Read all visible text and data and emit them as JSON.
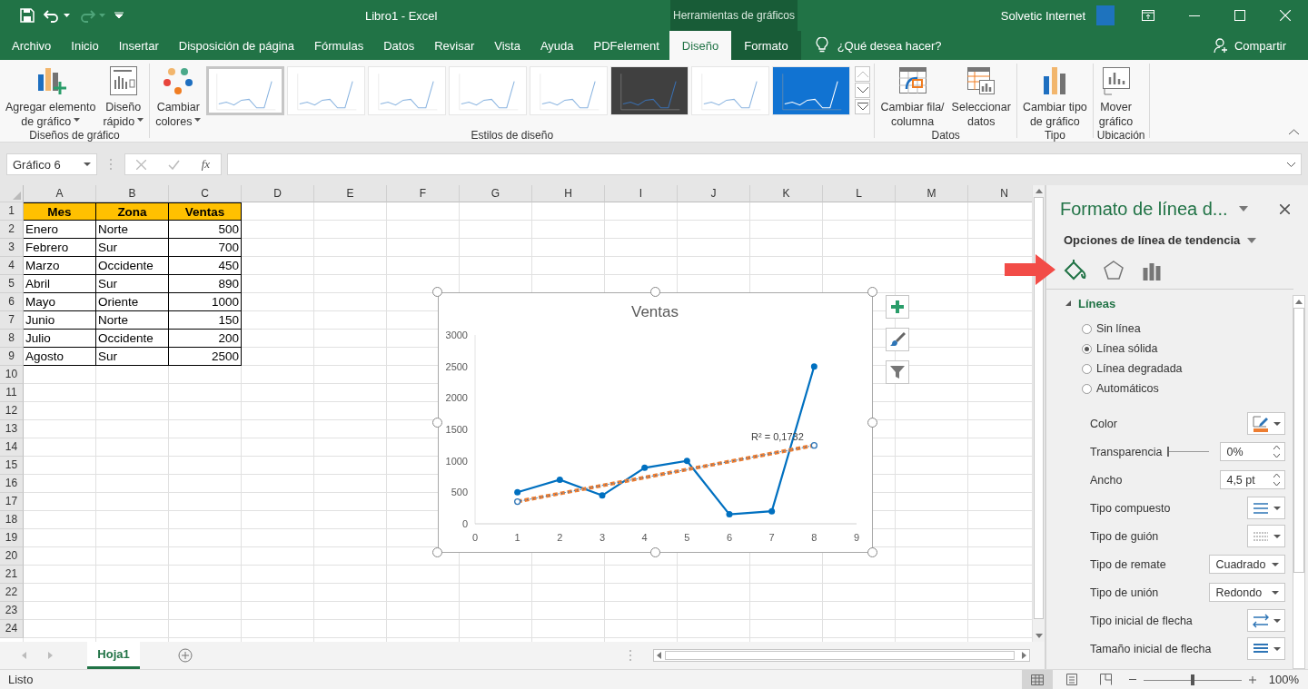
{
  "title_bar": {
    "title": "Libro1  -  Excel",
    "context_tab": "Herramientas de gráficos",
    "user": "Solvetic Internet"
  },
  "ribbon_tabs": [
    {
      "label": "Archivo",
      "selected": false,
      "contextual": false
    },
    {
      "label": "Inicio",
      "selected": false,
      "contextual": false
    },
    {
      "label": "Insertar",
      "selected": false,
      "contextual": false
    },
    {
      "label": "Disposición de página",
      "selected": false,
      "contextual": false
    },
    {
      "label": "Fórmulas",
      "selected": false,
      "contextual": false
    },
    {
      "label": "Datos",
      "selected": false,
      "contextual": false
    },
    {
      "label": "Revisar",
      "selected": false,
      "contextual": false
    },
    {
      "label": "Vista",
      "selected": false,
      "contextual": false
    },
    {
      "label": "Ayuda",
      "selected": false,
      "contextual": false
    },
    {
      "label": "PDFelement",
      "selected": false,
      "contextual": false
    },
    {
      "label": "Diseño",
      "selected": true,
      "contextual": true
    },
    {
      "label": "Formato",
      "selected": false,
      "contextual": true
    }
  ],
  "tell_me": "¿Qué desea hacer?",
  "share_button": "Compartir",
  "ribbon_groups": [
    {
      "label": "Diseños de gráfico",
      "buttons": [
        {
          "kind": "add-element",
          "lines": [
            "Agregar elemento",
            "de gráfico"
          ],
          "dropdown": true
        },
        {
          "kind": "quick-layout",
          "lines": [
            "Diseño",
            "rápido"
          ],
          "dropdown": true
        }
      ]
    },
    {
      "label": "Estilos de diseño",
      "buttons": [
        {
          "kind": "colors",
          "lines": [
            "Cambiar",
            "colores"
          ],
          "dropdown": true
        }
      ],
      "gallery": [
        {
          "kind": "light",
          "selected": true
        },
        {
          "kind": "light",
          "selected": false
        },
        {
          "kind": "light",
          "selected": false
        },
        {
          "kind": "light",
          "selected": false
        },
        {
          "kind": "light",
          "selected": false
        },
        {
          "kind": "dark",
          "selected": false
        },
        {
          "kind": "light",
          "selected": false
        },
        {
          "kind": "blue",
          "selected": false
        }
      ]
    },
    {
      "label": "Datos",
      "buttons": [
        {
          "kind": "switch",
          "lines": [
            "Cambiar fila/",
            "columna"
          ],
          "dropdown": false
        },
        {
          "kind": "select-data",
          "lines": [
            "Seleccionar",
            "datos"
          ],
          "dropdown": false
        }
      ]
    },
    {
      "label": "Tipo",
      "buttons": [
        {
          "kind": "chart-type",
          "lines": [
            "Cambiar tipo",
            "de gráfico"
          ],
          "dropdown": false
        }
      ]
    },
    {
      "label": "Ubicación",
      "buttons": [
        {
          "kind": "move",
          "lines": [
            "Mover",
            "gráfico"
          ],
          "dropdown": false
        }
      ]
    }
  ],
  "formula_bar": {
    "name_box": "Gráfico 6",
    "function_label": "fx"
  },
  "sheet": {
    "columns": [
      "A",
      "B",
      "C",
      "D",
      "E",
      "F",
      "G",
      "H",
      "I",
      "J",
      "K",
      "L",
      "M",
      "N"
    ],
    "rows": [
      {
        "number": "1",
        "kind": "header",
        "cells": [
          "Mes",
          "Zona",
          "Ventas"
        ]
      },
      {
        "number": "2",
        "kind": "data",
        "cells": [
          "Enero",
          "Norte",
          "500"
        ]
      },
      {
        "number": "3",
        "kind": "data",
        "cells": [
          "Febrero",
          "Sur",
          "700"
        ]
      },
      {
        "number": "4",
        "kind": "data",
        "cells": [
          "Marzo",
          "Occidente",
          "450"
        ]
      },
      {
        "number": "5",
        "kind": "data",
        "cells": [
          "Abril",
          "Sur",
          "890"
        ]
      },
      {
        "number": "6",
        "kind": "data",
        "cells": [
          "Mayo",
          "Oriente",
          "1000"
        ]
      },
      {
        "number": "7",
        "kind": "data",
        "cells": [
          "Junio",
          "Norte",
          "150"
        ]
      },
      {
        "number": "8",
        "kind": "data",
        "cells": [
          "Julio",
          "Occidente",
          "200"
        ]
      },
      {
        "number": "9",
        "kind": "data",
        "cells": [
          "Agosto",
          "Sur",
          "2500"
        ]
      },
      {
        "number": "10"
      },
      {
        "number": "11"
      },
      {
        "number": "12"
      },
      {
        "number": "13"
      },
      {
        "number": "14"
      },
      {
        "number": "15"
      },
      {
        "number": "16"
      },
      {
        "number": "17"
      },
      {
        "number": "18"
      },
      {
        "number": "19"
      },
      {
        "number": "20"
      },
      {
        "number": "21"
      },
      {
        "number": "22"
      },
      {
        "number": "23"
      },
      {
        "number": "24"
      }
    ]
  },
  "chart": {
    "chart_data": {
      "type": "line",
      "title": "Ventas",
      "x": [
        1,
        2,
        3,
        4,
        5,
        6,
        7,
        8
      ],
      "series": [
        {
          "color": "#0070c0",
          "marker": true,
          "line_style": "solid",
          "values": [
            500,
            700,
            450,
            890,
            1000,
            150,
            200,
            2500
          ]
        },
        {
          "color": "#ed7d31",
          "marker": false,
          "line_style": "dashed",
          "values": [
            353,
            480,
            608,
            735,
            863,
            990,
            1118,
            1245
          ]
        }
      ],
      "xlim": [
        0,
        9
      ],
      "ylim": [
        0,
        3000
      ],
      "xticks": [
        0,
        1,
        2,
        3,
        4,
        5,
        6,
        7,
        8,
        9
      ],
      "yticks": [
        0,
        500,
        1000,
        1500,
        2000,
        2500,
        3000
      ],
      "annotations": [
        "R² = 0,1732"
      ]
    }
  },
  "panel": {
    "title": "Formato de línea d...",
    "subtitle": "Opciones de línea de tendencia",
    "tabs": [
      {
        "kind": "fill",
        "selected": true
      },
      {
        "kind": "effects",
        "selected": false
      },
      {
        "kind": "options",
        "selected": false
      }
    ],
    "section": {
      "label": "Líneas",
      "expanded": true
    },
    "line_options": [
      {
        "label": "Sin línea",
        "selected": false
      },
      {
        "label": "Línea sólida",
        "selected": true
      },
      {
        "label": "Línea degradada",
        "selected": false
      },
      {
        "label": "Automáticos",
        "selected": false
      }
    ],
    "properties": [
      {
        "kind": "color",
        "label": "Color",
        "color": "#ed7d31"
      },
      {
        "kind": "slider",
        "label": "Transparencia",
        "level": 0,
        "value": "0%"
      },
      {
        "kind": "spin",
        "label": "Ancho",
        "value": "4,5 pt"
      },
      {
        "kind": "compound",
        "label": "Tipo compuesto"
      },
      {
        "kind": "dash",
        "label": "Tipo de guión"
      },
      {
        "kind": "dropdown",
        "label": "Tipo de remate",
        "value": "Cuadrado"
      },
      {
        "kind": "dropdown",
        "label": "Tipo de unión",
        "value": "Redondo"
      },
      {
        "kind": "arrow-type",
        "label": "Tipo inicial de flecha"
      },
      {
        "kind": "arrow-size",
        "label": "Tamaño inicial de flecha"
      }
    ]
  },
  "sheet_tabs": [
    {
      "label": "Hoja1",
      "selected": true
    }
  ],
  "status_bar": {
    "status": "Listo",
    "views": [
      {
        "kind": "normal",
        "selected": true
      },
      {
        "kind": "page-layout",
        "selected": false
      },
      {
        "kind": "page-break",
        "selected": false
      }
    ],
    "zoom_slider": {
      "level": 0.5
    },
    "zoom": "100%"
  }
}
